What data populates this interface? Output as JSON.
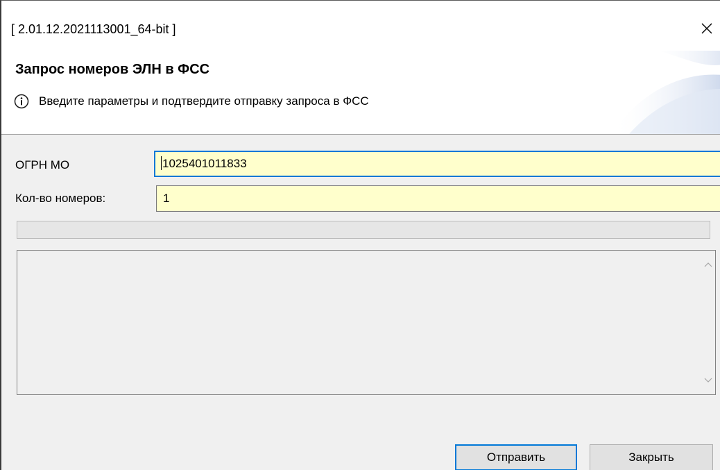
{
  "window": {
    "title": "[ 2.01.12.2021113001_64-bit ]",
    "close_icon": "close-icon"
  },
  "banner": {
    "title": "Запрос номеров ЭЛН в ФСС",
    "info_icon": "info-icon",
    "info_text": "Введите параметры и подтвердите отправку запроса в ФСС"
  },
  "form": {
    "ogrn_label": "ОГРН МО",
    "ogrn_value": "1025401011833",
    "count_label": "Кол-во номеров:",
    "count_value": "1"
  },
  "progress": {
    "value": 0
  },
  "log": {
    "text": ""
  },
  "buttons": {
    "send_label": "Отправить",
    "close_label": "Закрыть"
  },
  "colors": {
    "input_background": "#ffffcc",
    "focus_border": "#0078d7",
    "panel_background": "#f0f0f0"
  }
}
